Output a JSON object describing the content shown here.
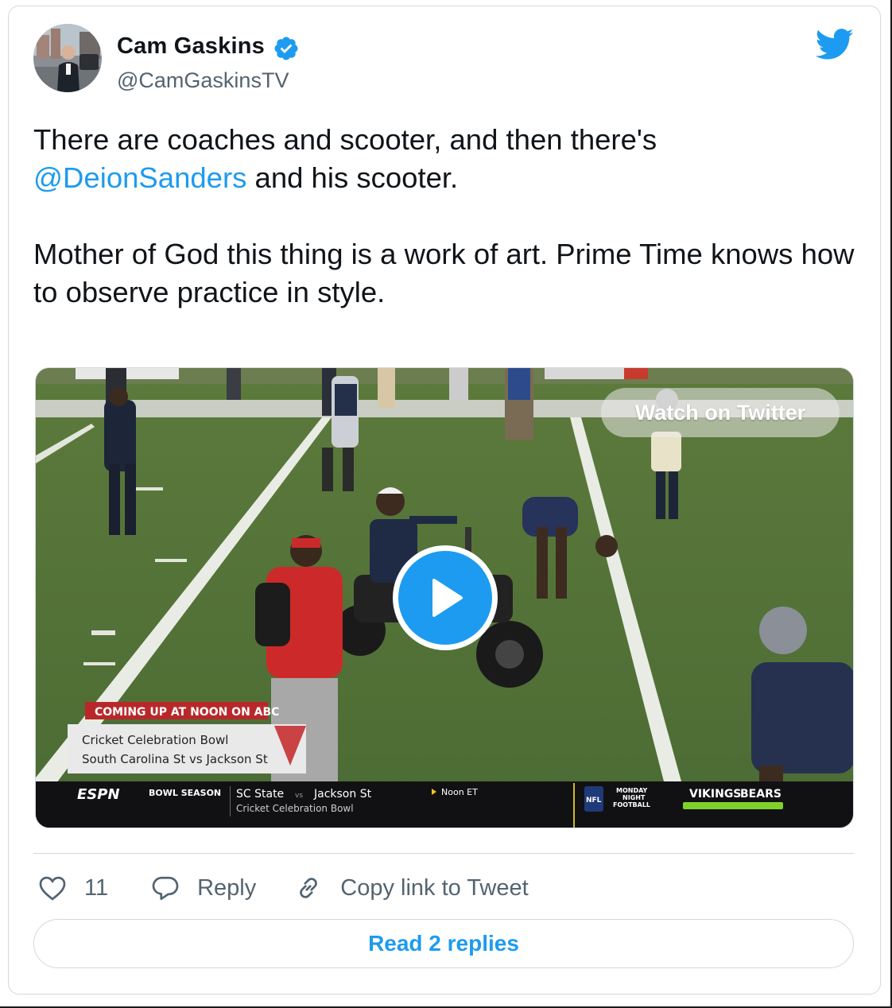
{
  "author": {
    "name": "Cam Gaskins",
    "handle": "@CamGaskinsTV",
    "verified": true
  },
  "tweet": {
    "line1_pre": "There are coaches and scooter, and then there's",
    "mention": "@DeionSanders",
    "line1_post": " and his scooter.",
    "paragraph2": "Mother of God this thing is a work of art. Prime Time knows how to observe practice in style."
  },
  "media": {
    "watch_label": "Watch on Twitter",
    "broadcast": {
      "promo_header": "COMING UP AT NOON ON ABC",
      "promo_line1": "Cricket Celebration Bowl",
      "promo_line2": "South Carolina St vs Jackson St",
      "network": "ESPN",
      "segment": "BOWL SEASON",
      "team_left": "SC State",
      "versus": "vs",
      "team_right": "Jackson St",
      "game_name": "Cricket Celebration Bowl",
      "time": "Noon ET",
      "mnf_line1": "MONDAY",
      "mnf_line2": "NIGHT",
      "mnf_line3": "FOOTBALL",
      "matchup_left": "VIKINGS",
      "matchup_right": "BEARS",
      "nfl": "NFL"
    }
  },
  "actions": {
    "like_count": "11",
    "reply_label": "Reply",
    "copy_label": "Copy link to Tweet"
  },
  "read_replies_label": "Read 2 replies",
  "colors": {
    "accent": "#1d9bf0",
    "secondary_text": "#536471",
    "border": "#cfd9de"
  }
}
